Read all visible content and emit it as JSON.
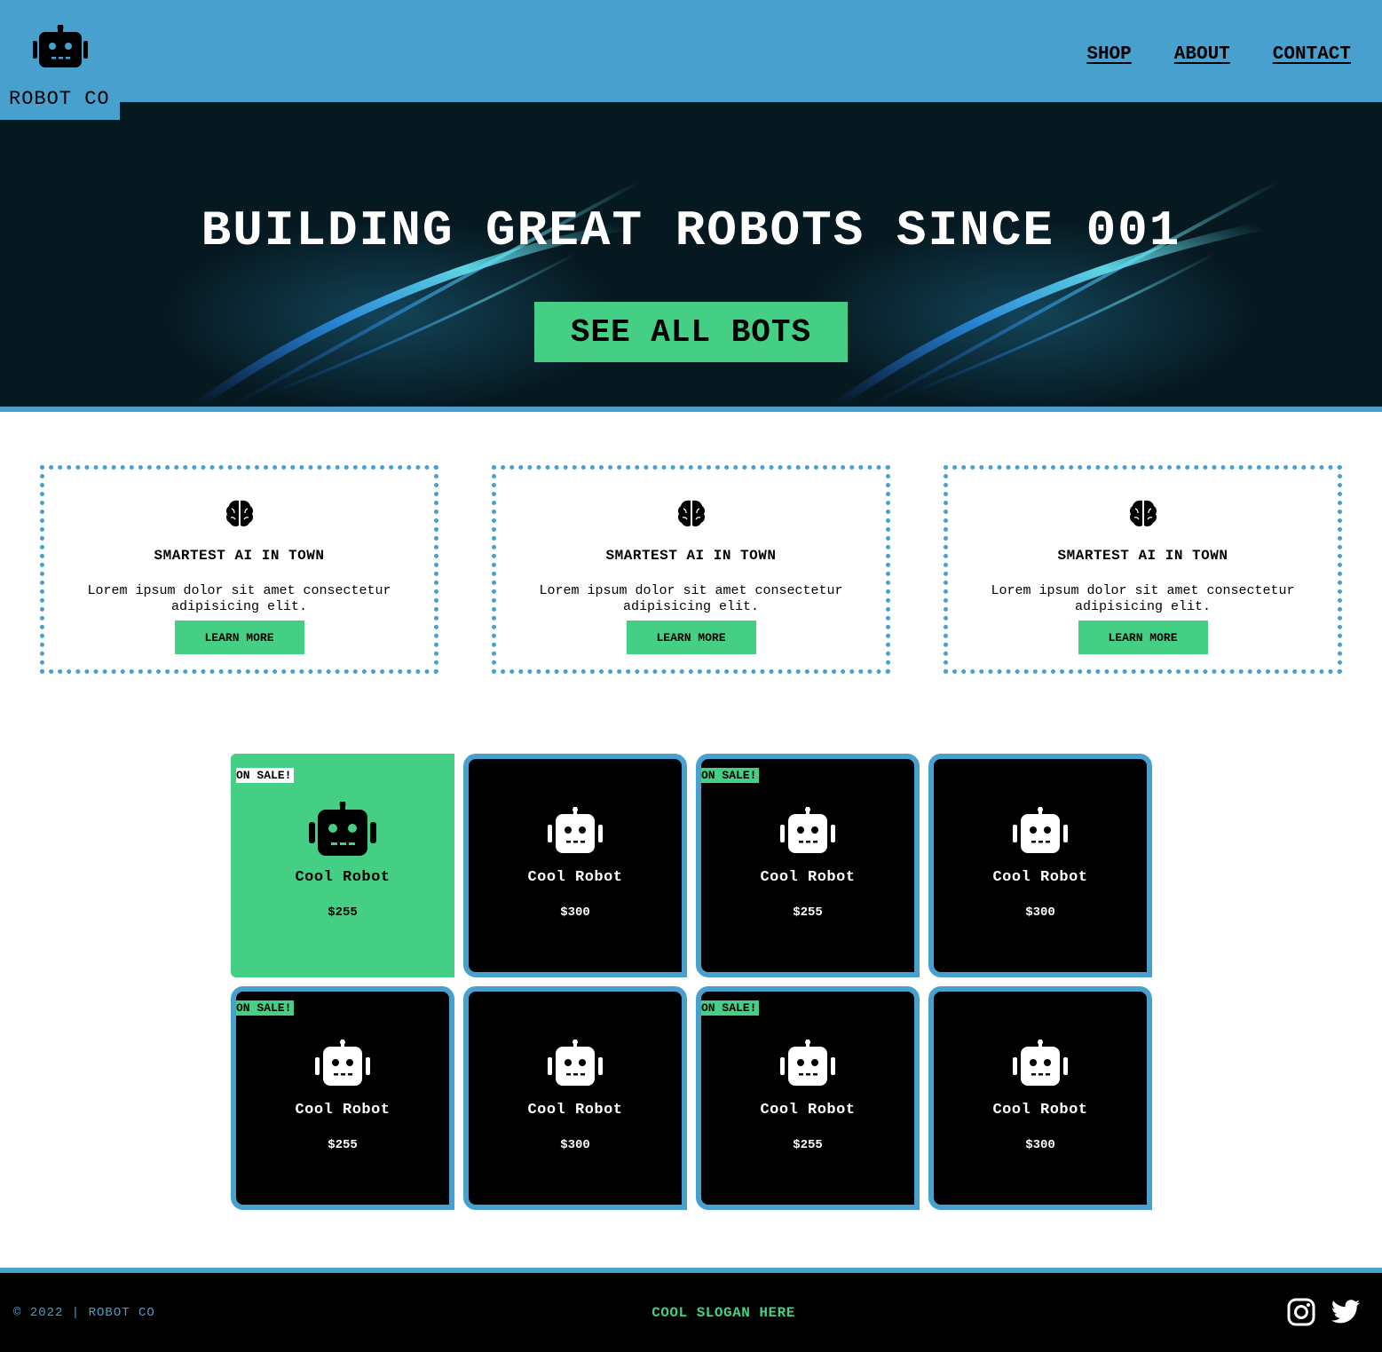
{
  "header": {
    "brand": "ROBOT CO",
    "logo_icon": "robot-icon",
    "nav": [
      "SHOP",
      "ABOUT",
      "CONTACT"
    ]
  },
  "hero": {
    "title": "BUILDING GREAT ROBOTS SINCE 001",
    "button": "SEE ALL BOTS"
  },
  "features": [
    {
      "icon": "brain-icon",
      "title": "SMARTEST AI IN TOWN",
      "text": "Lorem ipsum dolor sit amet consectetur adipisicing elit.",
      "button": "LEARN MORE"
    },
    {
      "icon": "brain-icon",
      "title": "SMARTEST AI IN TOWN",
      "text": "Lorem ipsum dolor sit amet consectetur adipisicing elit.",
      "button": "LEARN MORE"
    },
    {
      "icon": "brain-icon",
      "title": "SMARTEST AI IN TOWN",
      "text": "Lorem ipsum dolor sit amet consectetur adipisicing elit.",
      "button": "LEARN MORE"
    }
  ],
  "products": [
    {
      "name": "Cool Robot",
      "price": "$255",
      "badge": "ON SALE!",
      "icon": "robot-icon"
    },
    {
      "name": "Cool Robot",
      "price": "$300",
      "badge": "",
      "icon": "robot-icon"
    },
    {
      "name": "Cool Robot",
      "price": "$255",
      "badge": "ON SALE!",
      "icon": "robot-icon"
    },
    {
      "name": "Cool Robot",
      "price": "$300",
      "badge": "",
      "icon": "robot-icon"
    },
    {
      "name": "Cool Robot",
      "price": "$255",
      "badge": "ON SALE!",
      "icon": "robot-icon"
    },
    {
      "name": "Cool Robot",
      "price": "$300",
      "badge": "",
      "icon": "robot-icon"
    },
    {
      "name": "Cool Robot",
      "price": "$255",
      "badge": "ON SALE!",
      "icon": "robot-icon"
    },
    {
      "name": "Cool Robot",
      "price": "$300",
      "badge": "",
      "icon": "robot-icon"
    }
  ],
  "footer": {
    "copyright": "© 2022 | ROBOT CO",
    "slogan": "COOL SLOGAN HERE",
    "social_icons": [
      "instagram-icon",
      "twitter-icon"
    ]
  },
  "colors": {
    "primary_blue": "#48a0ce",
    "accent_green": "#45cf85",
    "hero_bg": "#061820",
    "footer_bg": "#000000"
  }
}
